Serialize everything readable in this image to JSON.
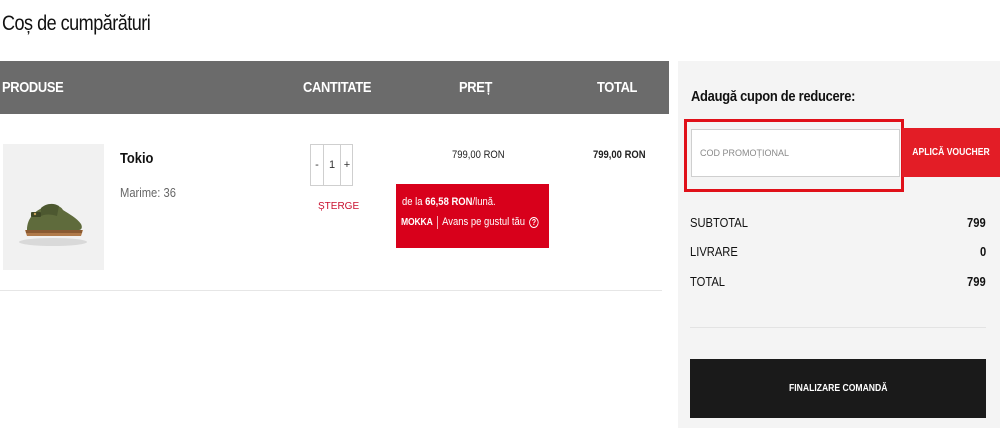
{
  "page": {
    "title": "Coș de cumpărături"
  },
  "cart_table": {
    "headers": {
      "products": "PRODUSE",
      "quantity": "CANTITATE",
      "price": "PREȚ",
      "total": "TOTAL"
    },
    "items": [
      {
        "name": "Tokio",
        "size_label": "Marime: 36",
        "quantity": "1",
        "qty_minus": "-",
        "qty_plus": "+",
        "remove_label": "ȘTERGE",
        "unit_price": "799,00 RON",
        "line_total": "799,00 RON",
        "image_icon": "green-clog-shoe-icon"
      }
    ]
  },
  "mokka": {
    "prefix": "de la ",
    "amount": "66,58 RON",
    "suffix": "/lună.",
    "logo": "MOKKA",
    "tagline": "Avans pe gustul tău",
    "info_icon": "?",
    "color": "#d8001b"
  },
  "summary": {
    "coupon_title": "Adaugă cupon de reducere:",
    "coupon_placeholder": "COD PROMOȚIONAL",
    "apply_button": "APLICĂ VOUCHER",
    "subtotal_label": "SUBTOTAL",
    "subtotal_value": "799",
    "shipping_label": "LIVRARE",
    "shipping_value": "0",
    "total_label": "TOTAL",
    "total_value": "799",
    "checkout_button": "FINALIZARE COMANDĂ"
  },
  "colors": {
    "header_bg": "#6b6b6b",
    "accent_red": "#e31d26",
    "highlight_frame": "#e01019",
    "checkout_bg": "#1a1a1a",
    "panel_bg": "#f4f4f4"
  }
}
